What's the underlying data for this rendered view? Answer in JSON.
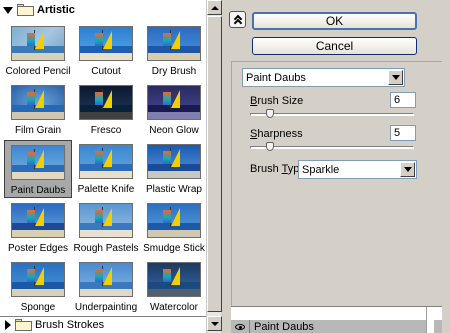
{
  "gallery": {
    "group_open": {
      "title": "Artistic"
    },
    "thumbnails": [
      {
        "label": "Colored Pencil",
        "style": "pencil"
      },
      {
        "label": "Cutout",
        "style": "cutout"
      },
      {
        "label": "Dry Brush",
        "style": "drybrush"
      },
      {
        "label": "Film Grain",
        "style": "filmgrain"
      },
      {
        "label": "Fresco",
        "style": "fresco"
      },
      {
        "label": "Neon Glow",
        "style": "neon"
      },
      {
        "label": "Paint Daubs",
        "style": "daubs",
        "selected": true
      },
      {
        "label": "Palette Knife",
        "style": "knife"
      },
      {
        "label": "Plastic Wrap",
        "style": "plastic"
      },
      {
        "label": "Poster Edges",
        "style": "poster"
      },
      {
        "label": "Rough Pastels",
        "style": "pastels"
      },
      {
        "label": "Smudge Stick",
        "style": "smudge"
      },
      {
        "label": "Sponge",
        "style": "sponge"
      },
      {
        "label": "Underpainting",
        "style": "under"
      },
      {
        "label": "Watercolor",
        "style": "watercolor"
      }
    ],
    "group_closed": {
      "title": "Brush Strokes"
    }
  },
  "buttons": {
    "ok": "OK",
    "cancel": "Cancel"
  },
  "settings": {
    "filter_select": "Paint Daubs",
    "brush_size": {
      "label_u": "B",
      "label_rest": "rush Size",
      "value": "6",
      "fraction": 0.12
    },
    "sharpness": {
      "label_u": "S",
      "label_rest": "harpness",
      "value": "5",
      "fraction": 0.12
    },
    "brush_type": {
      "label_pre": "Brush ",
      "label_u": "T",
      "label_post": "ype:",
      "value": "Sparkle"
    }
  },
  "layers": {
    "active_layer": "Paint Daubs"
  }
}
